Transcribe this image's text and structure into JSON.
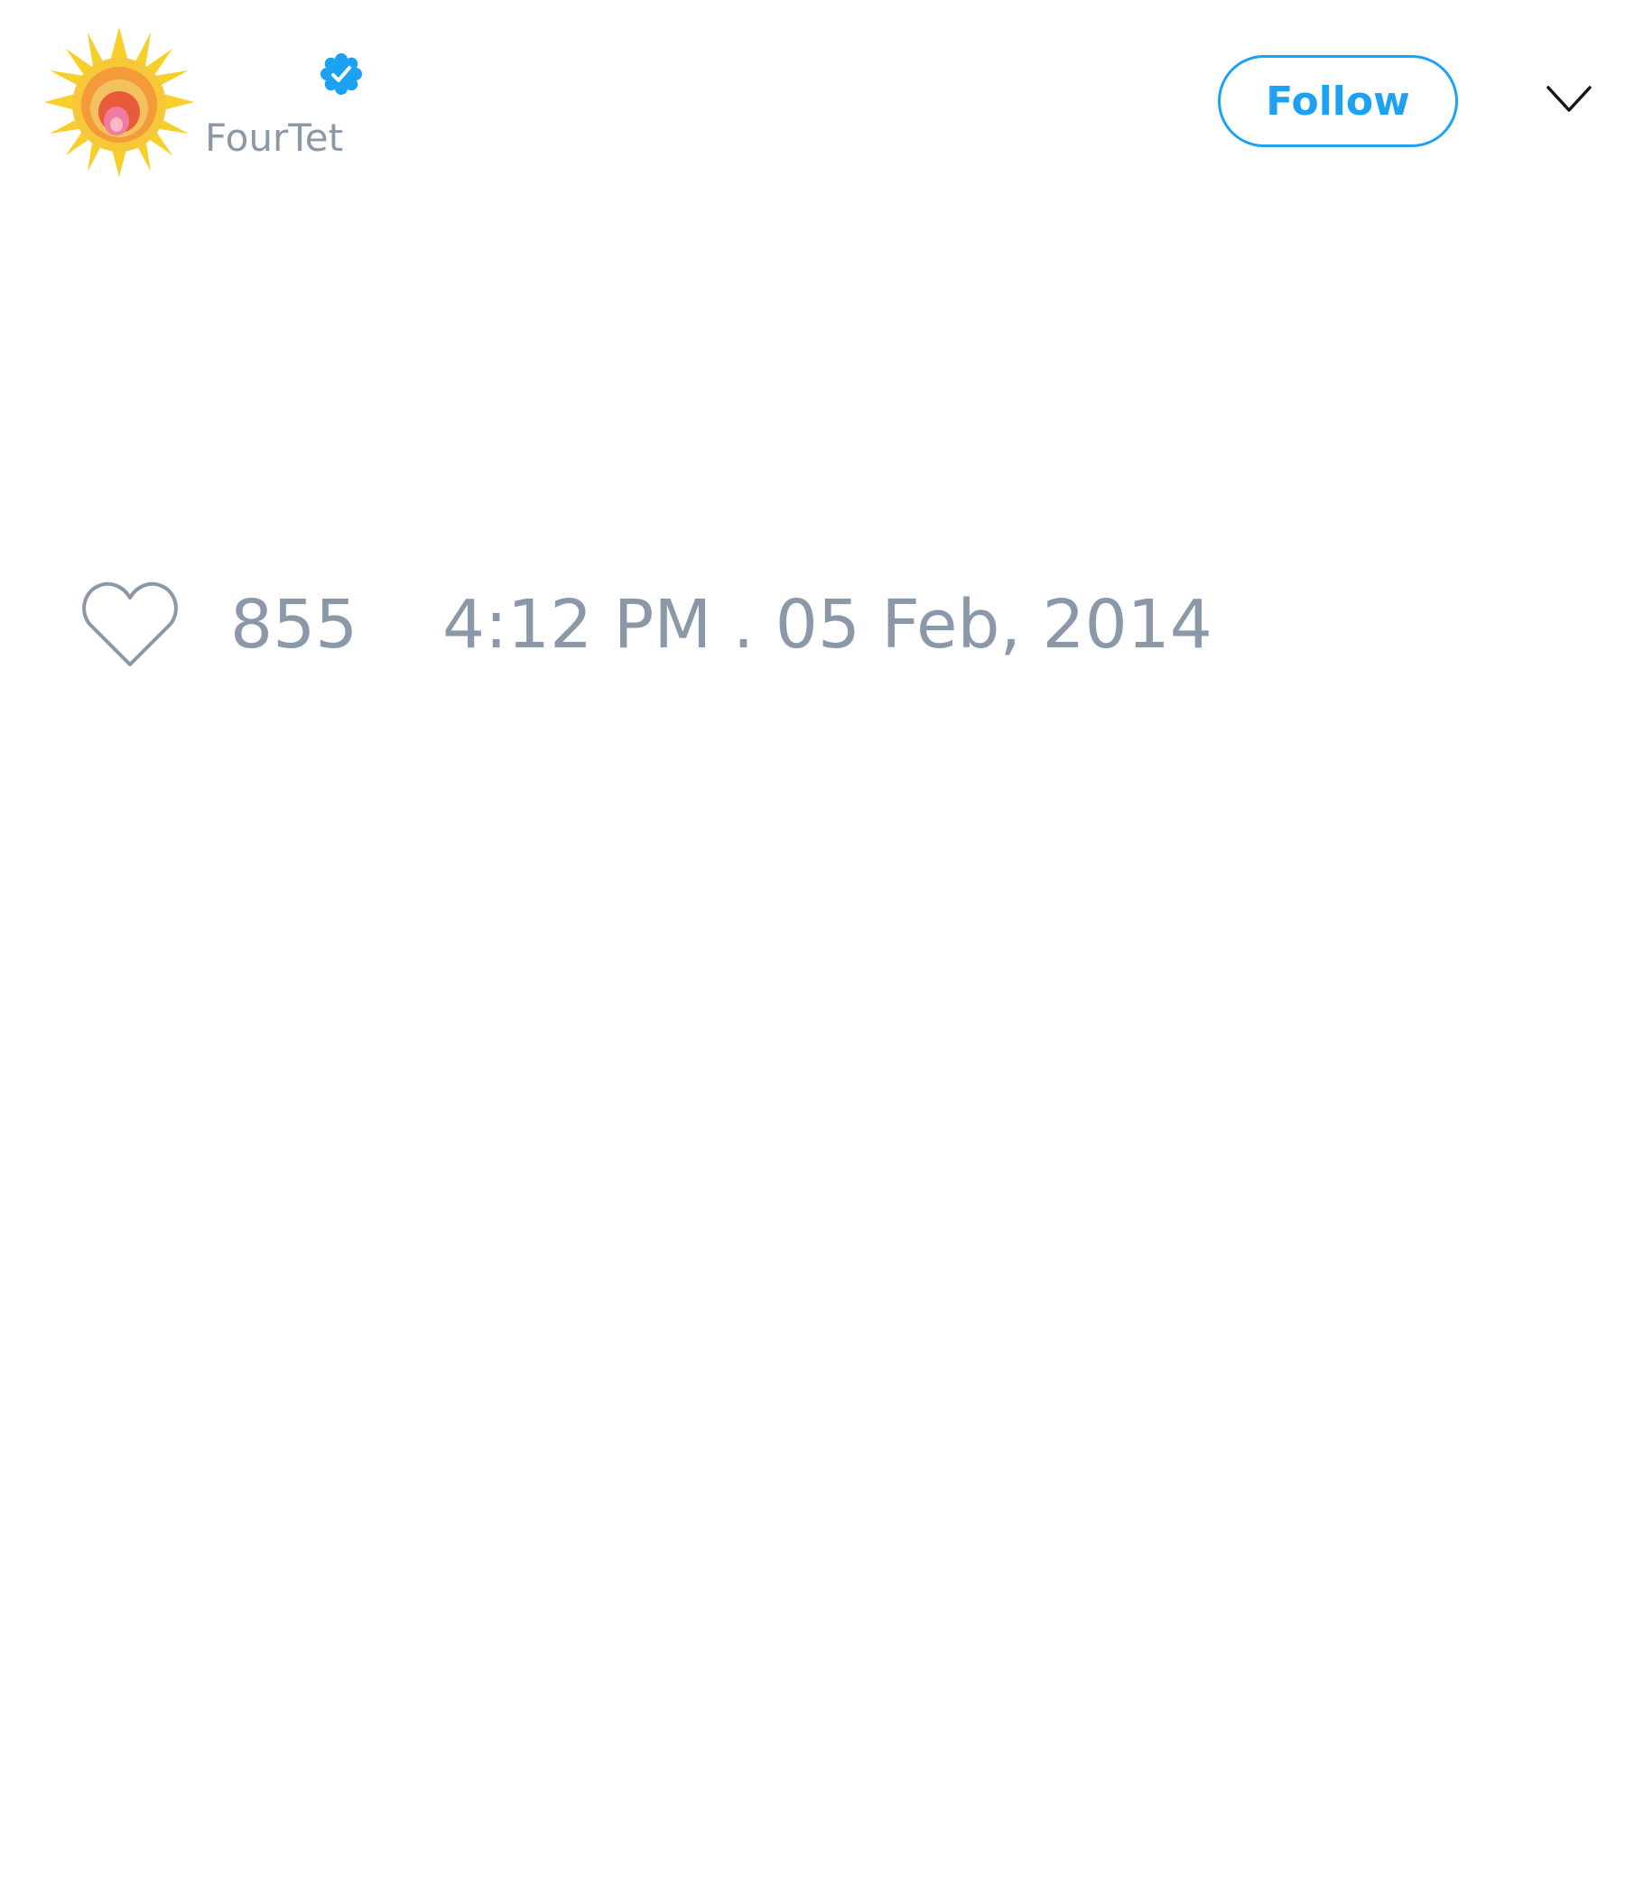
{
  "author": {
    "handle": "FourTet",
    "verified": true,
    "avatar_icon": "sun-avatar-icon",
    "verified_icon": "verified-badge-icon"
  },
  "actions": {
    "follow_label": "Follow",
    "menu_icon": "chevron-down-icon"
  },
  "tweet": {
    "like_icon": "heart-outline-icon",
    "like_count": "855",
    "timestamp": "4:12 PM . 05 Feb, 2014"
  },
  "colors": {
    "accent": "#1da1f2",
    "muted_text": "#8b98a8",
    "background": "#ffffff"
  }
}
